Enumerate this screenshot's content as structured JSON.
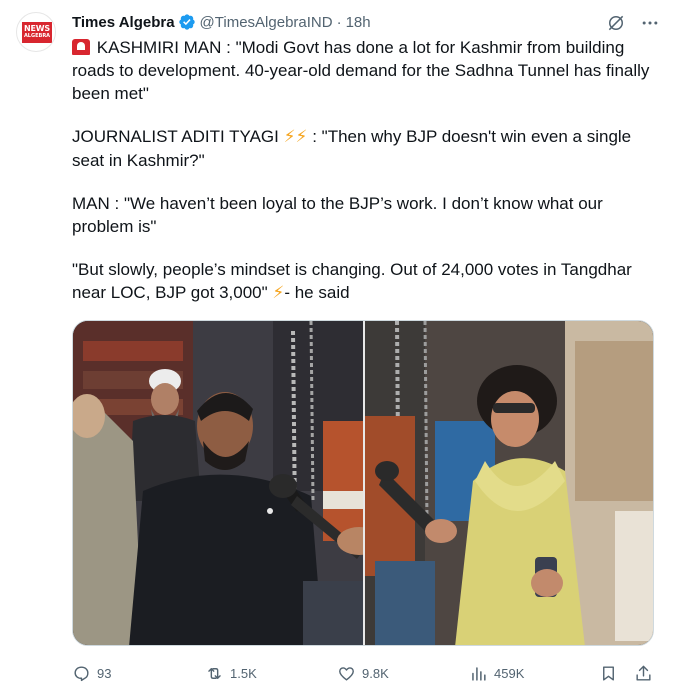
{
  "author": {
    "name": "Times Algebra",
    "handle": "@TimesAlgebraIND",
    "separator": "·",
    "time": "18h",
    "avatar_line1": "NEWS",
    "avatar_line2": "ALGEBRA"
  },
  "tweet": {
    "p1_prefix": "KASHMIRI MAN : \"Modi Govt has done a lot for Kashmir from building roads to development. 40-year-old demand for the Sadhna Tunnel has finally been met\"",
    "p2_prefix": "JOURNALIST ADITI TYAGI ",
    "p2_bolts": "⚡⚡",
    "p2_suffix": " : \"Then why BJP doesn't win even a single seat in Kashmir?\"",
    "p3": "MAN : \"We haven’t been loyal to the BJP’s work. I don’t know what our problem is\"",
    "p4_prefix": "\"But slowly, people’s mindset is changing. Out of 24,000 votes in Tangdhar near LOC, BJP got 3,000\" ",
    "p4_bolt": "⚡",
    "p4_suffix": "- he said"
  },
  "actions": {
    "replies": "93",
    "reposts": "1.5K",
    "likes": "9.8K",
    "views": "459K"
  },
  "icons": {
    "verified": "verified-badge-icon",
    "grok": "grok-icon",
    "more": "more-icon",
    "reply": "reply-icon",
    "repost": "repost-icon",
    "like": "like-icon",
    "views": "views-icon",
    "bookmark": "bookmark-icon",
    "share": "share-icon",
    "siren": "siren-emoji-icon"
  },
  "colors": {
    "text": "#0f1419",
    "muted": "#536471",
    "verified": "#1d9bf0",
    "brand": "#d8262f"
  }
}
